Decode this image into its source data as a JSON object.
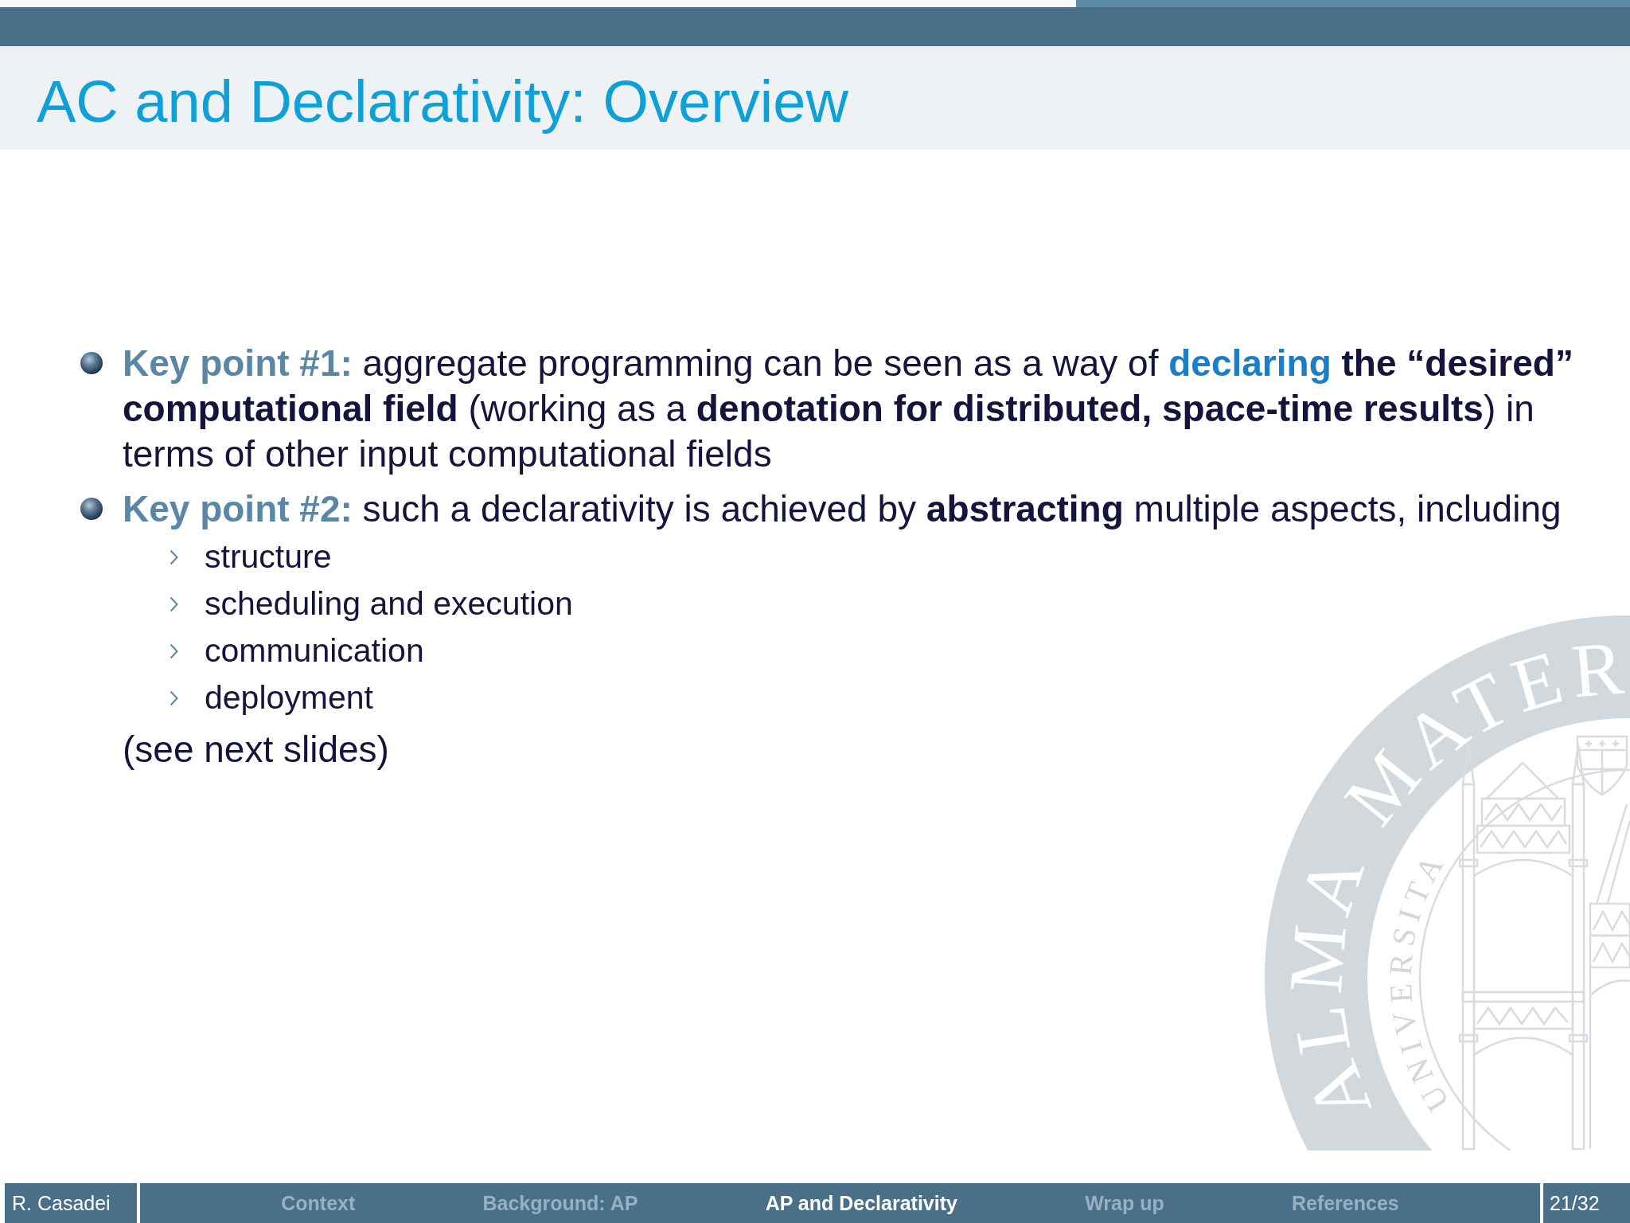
{
  "header": {
    "progress": {
      "level": 0.66
    }
  },
  "title": "AC and Declarativity: Overview",
  "bullets": [
    {
      "label": "Key point #1:",
      "runs": [
        {
          "kind": "plain",
          "text": " aggregate programming can be seen as a way of "
        },
        {
          "kind": "accent",
          "text": "declaring"
        },
        {
          "kind": "bold",
          "text": " the “desired” computational field"
        },
        {
          "kind": "plain",
          "text": " (working as a "
        },
        {
          "kind": "bold",
          "text": "denotation for distributed, space-time results"
        },
        {
          "kind": "plain",
          "text": ") in terms of other input computational fields"
        }
      ]
    },
    {
      "label": "Key point #2:",
      "runs": [
        {
          "kind": "plain",
          "text": " such a declarativity is achieved by "
        },
        {
          "kind": "bold",
          "text": "abstracting"
        },
        {
          "kind": "plain",
          "text": " multiple aspects, including"
        }
      ],
      "subitems": [
        "structure",
        "scheduling and execution",
        "communication",
        "deployment"
      ]
    }
  ],
  "note": "(see next slides)",
  "seal": {
    "outer_words": [
      "ALMA",
      "MATER"
    ],
    "inner_text": "UNIVERSITA"
  },
  "footer": {
    "author": "R. Casadei",
    "sections": [
      {
        "label": "Context",
        "selected": false
      },
      {
        "label": "Background: AP",
        "selected": false
      },
      {
        "label": "AP and Declarativity",
        "selected": true
      },
      {
        "label": "Wrap up",
        "selected": false
      },
      {
        "label": "References",
        "selected": false
      }
    ],
    "page": "21/32"
  }
}
